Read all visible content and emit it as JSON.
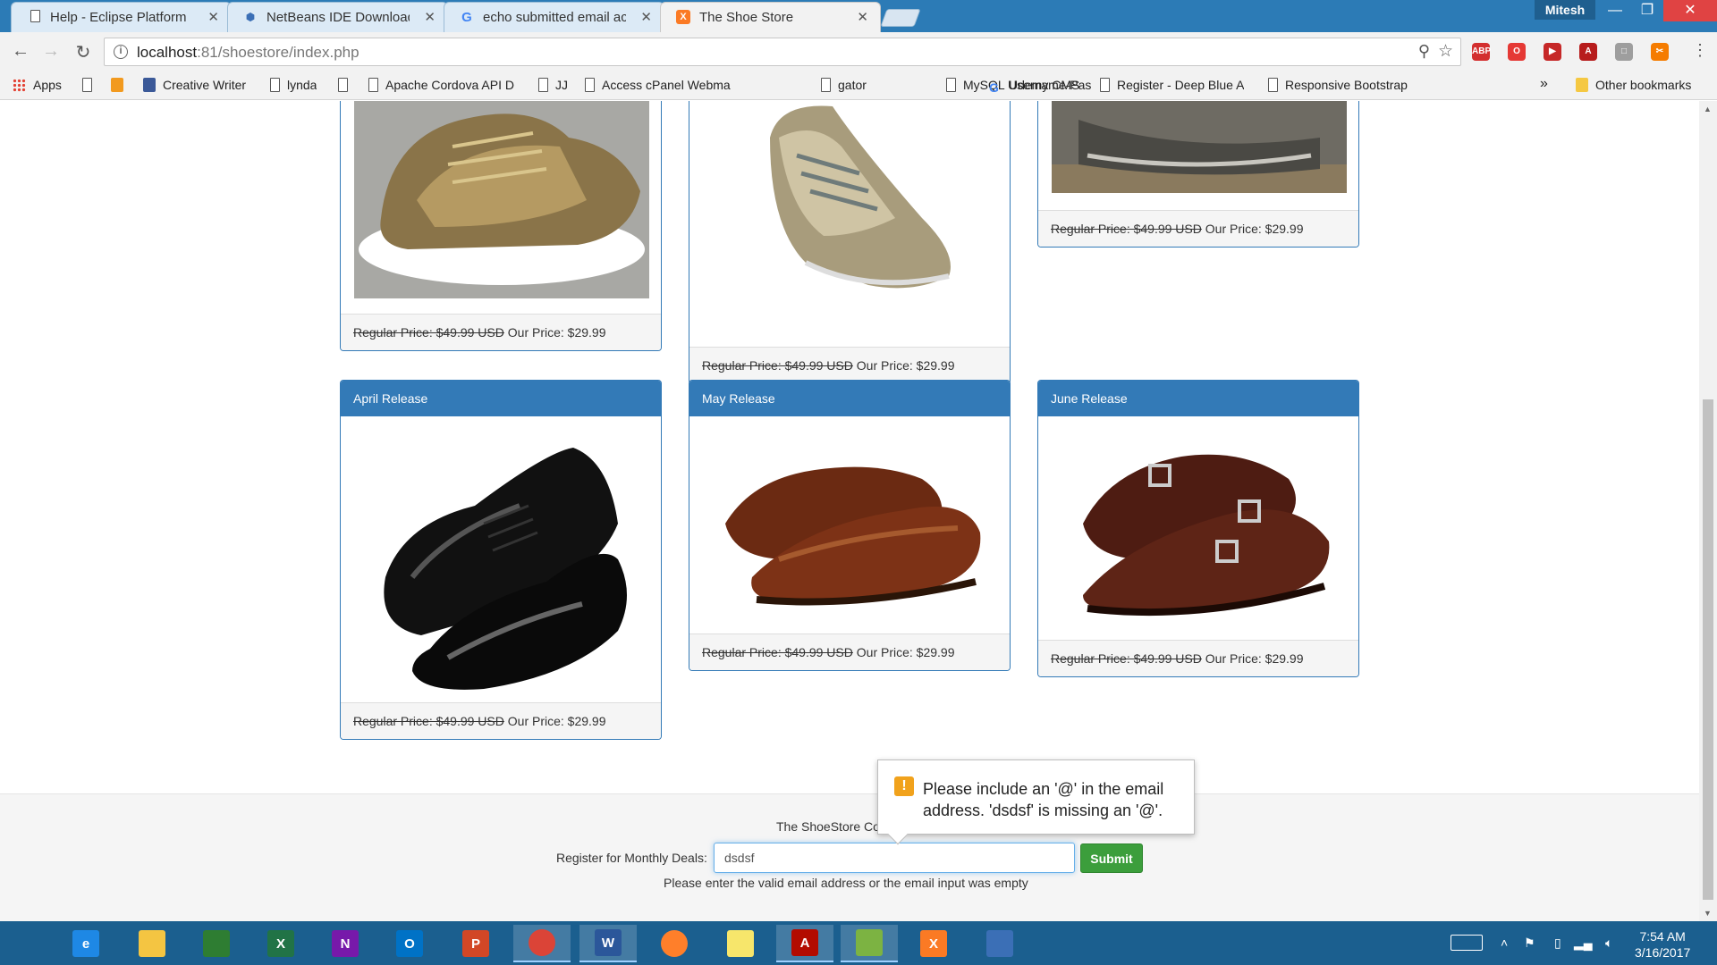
{
  "browser": {
    "tabs": [
      {
        "title": "Help - Eclipse Platform",
        "icon": "page-icon",
        "active": false
      },
      {
        "title": "NetBeans IDE Download",
        "icon": "netbeans-icon",
        "active": false
      },
      {
        "title": "echo submitted email ac",
        "icon": "google-icon",
        "active": false
      },
      {
        "title": "The Shoe Store",
        "icon": "xampp-icon",
        "active": true
      }
    ],
    "profile_name": "Mitesh",
    "window_buttons": {
      "minimize": "—",
      "restore": "❐",
      "close": "✕"
    },
    "url_host": "localhost",
    "url_rest": ":81/shoestore/index.php",
    "extensions": [
      {
        "label": "ABP",
        "color": "#d32f2f"
      },
      {
        "label": "O",
        "color": "#e53935"
      },
      {
        "label": "▶",
        "color": "#c62828"
      },
      {
        "label": "A",
        "color": "#b71c1c"
      },
      {
        "label": "□",
        "color": "#9e9e9e"
      },
      {
        "label": "✂",
        "color": "#f57c00"
      }
    ],
    "bookmarks": [
      {
        "label": "Apps",
        "icon": "apps-icon"
      },
      {
        "label": "",
        "icon": "page-icon"
      },
      {
        "label": "",
        "icon": "rss-icon"
      },
      {
        "label": "Creative Writer",
        "icon": "facebook-icon"
      },
      {
        "label": "lynda",
        "icon": "page-icon"
      },
      {
        "label": "",
        "icon": "page-icon"
      },
      {
        "label": "Apache Cordova API D",
        "icon": "page-icon"
      },
      {
        "label": "JJ",
        "icon": "page-icon"
      },
      {
        "label": "Access cPanel Webma",
        "icon": "page-icon"
      },
      {
        "label": "gator",
        "icon": "page-icon"
      },
      {
        "label": "MySQL Username-Pas",
        "icon": "page-icon"
      },
      {
        "label": "Udemy CMS",
        "icon": "google-icon"
      },
      {
        "label": "Register - Deep Blue A",
        "icon": "page-icon"
      },
      {
        "label": "Responsive Bootstrap",
        "icon": "page-icon"
      }
    ],
    "bookmarks_overflow": "»",
    "other_bookmarks": "Other bookmarks"
  },
  "page": {
    "price_regular": "Regular Price: $49.99 USD",
    "price_ours": "Our Price: $29.99",
    "top_row": [
      {
        "title": ""
      },
      {
        "title": ""
      },
      {
        "title": ""
      }
    ],
    "bottom_row": [
      {
        "title": "April Release"
      },
      {
        "title": "May Release"
      },
      {
        "title": "June Release"
      }
    ],
    "footer": {
      "copyright": "The ShoeStore Co",
      "register_label": "Register for Monthly Deals:",
      "email_value": "dsdsf",
      "submit_label": "Submit",
      "error_text": "Please enter the valid email address or the email input was empty"
    },
    "validation_bubble": "Please include an '@' in the email address. 'dsdsf' is missing an '@'."
  },
  "taskbar": {
    "clock_time": "7:54 AM",
    "clock_date": "3/16/2017",
    "apps": [
      {
        "name": "start-icon",
        "label": "",
        "color": "#1b5f8f"
      },
      {
        "name": "internet-explorer-icon",
        "label": "e",
        "color": "#1e88e5"
      },
      {
        "name": "file-explorer-icon",
        "label": "",
        "color": "#f4c542"
      },
      {
        "name": "store-icon",
        "label": "",
        "color": "#2e7d32"
      },
      {
        "name": "excel-icon",
        "label": "X",
        "color": "#217346"
      },
      {
        "name": "onenote-icon",
        "label": "N",
        "color": "#7719aa"
      },
      {
        "name": "outlook-icon",
        "label": "O",
        "color": "#0072c6"
      },
      {
        "name": "powerpoint-icon",
        "label": "P",
        "color": "#d24726"
      },
      {
        "name": "chrome-icon",
        "label": "",
        "color": "#db4437"
      },
      {
        "name": "word-icon",
        "label": "W",
        "color": "#2b579a"
      },
      {
        "name": "firefox-icon",
        "label": "",
        "color": "#ff7f2a"
      },
      {
        "name": "sticky-notes-icon",
        "label": "",
        "color": "#f7e66b"
      },
      {
        "name": "acrobat-icon",
        "label": "A",
        "color": "#b30b00"
      },
      {
        "name": "notepad-icon",
        "label": "",
        "color": "#7cb342"
      },
      {
        "name": "xampp-icon",
        "label": "X",
        "color": "#fb7a24"
      },
      {
        "name": "virtualbox-icon",
        "label": "",
        "color": "#3b6fb6"
      }
    ]
  }
}
